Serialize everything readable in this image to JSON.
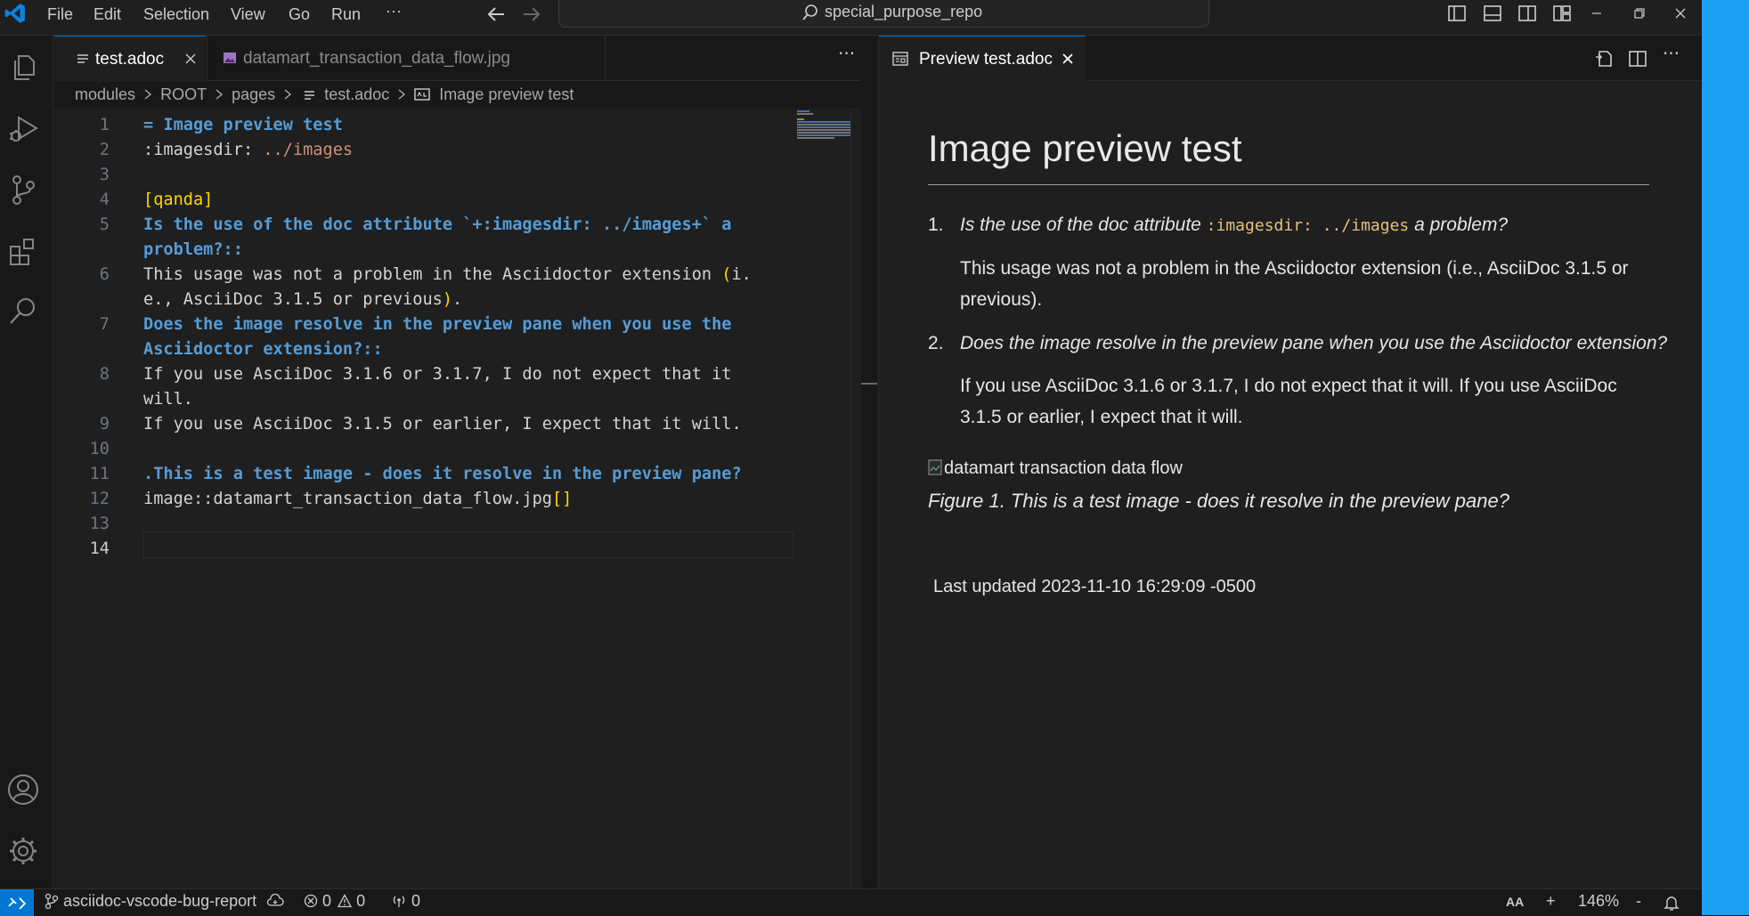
{
  "menu": [
    "File",
    "Edit",
    "Selection",
    "View",
    "Go",
    "Run",
    "···"
  ],
  "search": {
    "text": "special_purpose_repo"
  },
  "tabs": {
    "active": "test.adoc",
    "inactive": "datamart_transaction_data_flow.jpg",
    "more": "···"
  },
  "breadcrumb": [
    "modules",
    "ROOT",
    "pages",
    "test.adoc",
    "Image preview test"
  ],
  "code": {
    "line_numbers": [
      "1",
      "2",
      "3",
      "4",
      "5",
      "",
      "6",
      "",
      "7",
      "",
      "8",
      "",
      "9",
      "10",
      "11",
      "12",
      "13",
      "14"
    ],
    "l1": "= Image preview test",
    "l2_key": ":imagesdir:",
    "l2_val": " ../images",
    "l4": "[qanda]",
    "l5a": "Is the use of the doc attribute `+:imagesdir: ../images+` a",
    "l5b": "problem?::",
    "l6a": "This usage was not a problem in the Asciidoctor extension ",
    "l6a_paren": "(",
    "l6a_rest": "i.",
    "l6b": "e., AsciiDoc 3.1.5 or previous",
    "l6b_paren": ")",
    "l6b_end": ".",
    "l7a": "Does the image resolve in the preview pane when you use the",
    "l7b": "Asciidoctor extension?::",
    "l8a": "If you use AsciiDoc 3.1.6 or 3.1.7, I do not expect that it",
    "l8b": "will.",
    "l9": "If you use AsciiDoc 3.1.5 or earlier, I expect that it will.",
    "l11": ".This is a test image - does it resolve in the preview pane?",
    "l12": "image::datamart_transaction_data_flow.jpg",
    "l12_brackets": "[]"
  },
  "preview": {
    "tab_label": "Preview test.adoc",
    "title": "Image preview test",
    "q1_num": "1.",
    "q1_pre": "Is the use of the doc attribute ",
    "q1_code": ":imagesdir: ../images",
    "q1_post": " a problem?",
    "a1": "This usage was not a problem in the Asciidoctor extension (i.e., AsciiDoc 3.1.5 or previous).",
    "q2_num": "2.",
    "q2": "Does the image resolve in the preview pane when you use the Asciidoctor extension?",
    "a2": "If you use AsciiDoc 3.1.6 or 3.1.7, I do not expect that it will. If you use AsciiDoc 3.1.5 or earlier, I expect that it will.",
    "img_alt": "datamart transaction data flow",
    "caption": "Figure 1. This is a test image - does it resolve in the preview pane?",
    "updated": "Last updated 2023-11-10 16:29:09 -0500"
  },
  "status": {
    "branch": "asciidoc-vscode-bug-report",
    "errors": "0",
    "warnings": "0",
    "ports": "0",
    "font": "AA",
    "plus": "+",
    "zoom": "146%",
    "minus": "-"
  },
  "colors": {
    "accent": "#0078d4",
    "right_strip": "#1aa1f2"
  }
}
